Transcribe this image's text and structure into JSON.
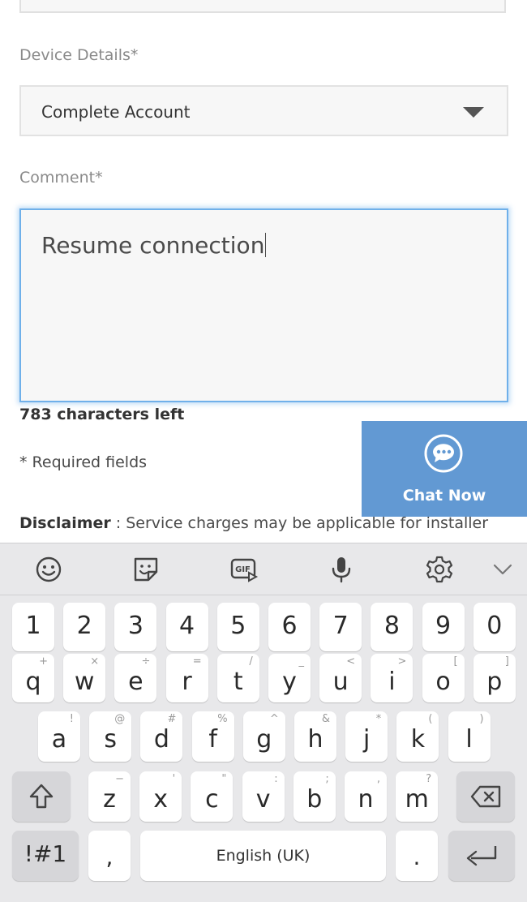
{
  "form": {
    "device_label": "Device Details*",
    "device_value": "Complete Account",
    "comment_label": "Comment*",
    "comment_value": "Resume connection",
    "chars_left": "783 characters left",
    "required_note": "* Required fields",
    "disclaimer_title": "Disclaimer",
    "disclaimer_text": " : Service charges may be applicable for installer"
  },
  "chat": {
    "label": "Chat Now",
    "color": "#6299d3"
  },
  "keyboard": {
    "toolbar_icons": [
      "emoji-icon",
      "sticker-icon",
      "gif-icon",
      "microphone-icon",
      "settings-icon",
      "chevron-down-icon"
    ],
    "number_row": [
      "1",
      "2",
      "3",
      "4",
      "5",
      "6",
      "7",
      "8",
      "9",
      "0"
    ],
    "row1": [
      {
        "main": "q",
        "hint": "+"
      },
      {
        "main": "w",
        "hint": "×"
      },
      {
        "main": "e",
        "hint": "÷"
      },
      {
        "main": "r",
        "hint": "="
      },
      {
        "main": "t",
        "hint": "/"
      },
      {
        "main": "y",
        "hint": "_"
      },
      {
        "main": "u",
        "hint": "<"
      },
      {
        "main": "i",
        "hint": ">"
      },
      {
        "main": "o",
        "hint": "["
      },
      {
        "main": "p",
        "hint": "]"
      }
    ],
    "row2": [
      {
        "main": "a",
        "hint": "!"
      },
      {
        "main": "s",
        "hint": "@"
      },
      {
        "main": "d",
        "hint": "#"
      },
      {
        "main": "f",
        "hint": "%"
      },
      {
        "main": "g",
        "hint": "^"
      },
      {
        "main": "h",
        "hint": "&"
      },
      {
        "main": "j",
        "hint": "*"
      },
      {
        "main": "k",
        "hint": "("
      },
      {
        "main": "l",
        "hint": ")"
      }
    ],
    "row3": [
      {
        "main": "z",
        "hint": "−"
      },
      {
        "main": "x",
        "hint": "'"
      },
      {
        "main": "c",
        "hint": "\""
      },
      {
        "main": "v",
        "hint": ":"
      },
      {
        "main": "b",
        "hint": ";"
      },
      {
        "main": "n",
        "hint": ","
      },
      {
        "main": "m",
        "hint": "?"
      }
    ],
    "symbols_label": "!#1",
    "comma_label": ",",
    "space_label": "English (UK)",
    "period_label": "."
  }
}
